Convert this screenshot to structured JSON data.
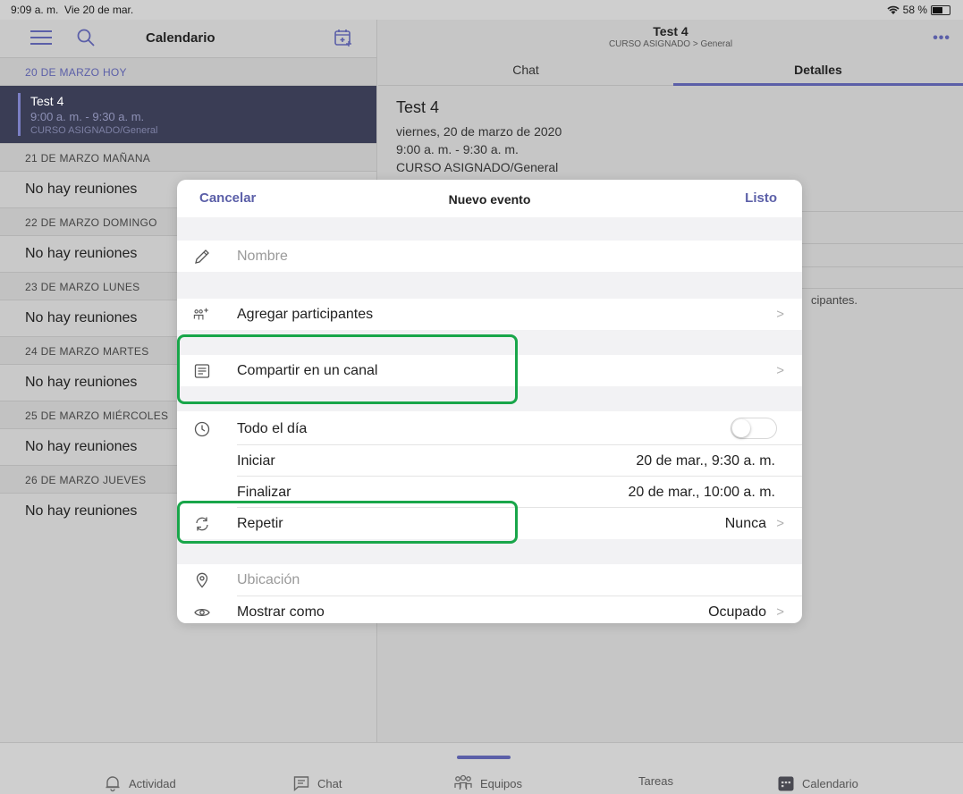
{
  "status_bar": {
    "time": "9:09 a. m.",
    "date": "Vie 20 de mar.",
    "battery": "58 %"
  },
  "left_pane": {
    "title": "Calendario",
    "sections": [
      {
        "header": "20 DE MARZO  HOY"
      },
      {
        "header": "21 DE MARZO  MAÑANA"
      },
      {
        "header": "22 DE MARZO  DOMINGO"
      },
      {
        "header": "23 DE MARZO  LUNES"
      },
      {
        "header": "24 DE MARZO  MARTES"
      },
      {
        "header": "25 DE MARZO  MIÉRCOLES"
      },
      {
        "header": "26 DE MARZO  JUEVES"
      }
    ],
    "meeting": {
      "title": "Test 4",
      "time": "9:00 a. m. - 9:30 a. m.",
      "channel": "CURSO ASIGNADO/General"
    },
    "no_meetings": "No hay reuniones"
  },
  "right_pane": {
    "title": "Test 4",
    "subtitle": "CURSO ASIGNADO > General",
    "tabs": {
      "chat": "Chat",
      "details": "Detalles"
    },
    "details": {
      "title": "Test 4",
      "date": "viernes, 20 de marzo de 2020",
      "time": "9:00 a. m. - 9:30 a. m.",
      "channel": "CURSO ASIGNADO/General",
      "participants_partial": "cipantes."
    }
  },
  "modal": {
    "cancel": "Cancelar",
    "title": "Nuevo evento",
    "done": "Listo",
    "name_placeholder": "Nombre",
    "add_participants": "Agregar participantes",
    "share_channel": "Compartir en un canal",
    "all_day": "Todo el día",
    "all_day_on": false,
    "start_label": "Iniciar",
    "start_value": "20 de mar., 9:30 a. m.",
    "end_label": "Finalizar",
    "end_value": "20 de mar., 10:00 a. m.",
    "repeat_label": "Repetir",
    "repeat_value": "Nunca",
    "location_placeholder": "Ubicación",
    "show_as_label": "Mostrar como",
    "show_as_value": "Ocupado"
  },
  "bottom_nav": {
    "activity": "Actividad",
    "chat": "Chat",
    "teams": "Equipos",
    "tasks": "Tareas",
    "calendar": "Calendario"
  },
  "colors": {
    "accent": "#5b5fa8",
    "highlight": "#19a64a",
    "selected_meeting": "#3a3d55"
  }
}
